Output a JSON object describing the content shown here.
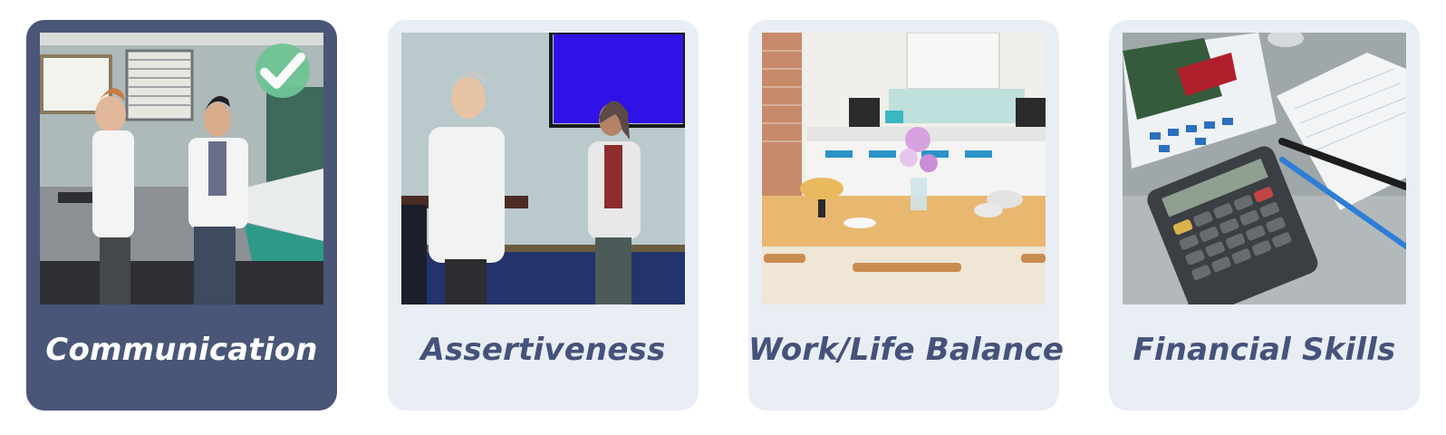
{
  "cards": [
    {
      "label": "Communication",
      "selected": true,
      "icon": "check-icon"
    },
    {
      "label": "Assertiveness",
      "selected": false
    },
    {
      "label": "Work/Life Balance",
      "selected": false
    },
    {
      "label": "Financial Skills",
      "selected": false
    }
  ],
  "colors": {
    "selected_bg": "#4a5677",
    "card_bg": "#e9eef5",
    "label": "#46527a",
    "selected_label": "#ffffff",
    "check_badge": "#6fc495"
  }
}
